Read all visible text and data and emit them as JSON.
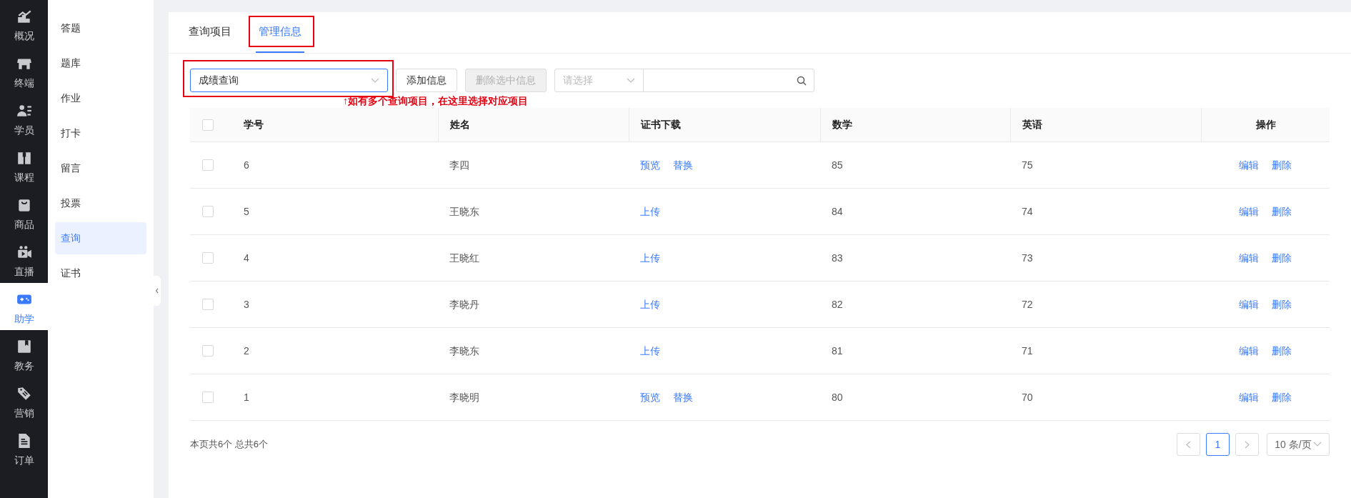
{
  "nav": [
    {
      "label": "概况",
      "selected": false
    },
    {
      "label": "终端",
      "selected": false
    },
    {
      "label": "学员",
      "selected": false
    },
    {
      "label": "课程",
      "selected": false
    },
    {
      "label": "商品",
      "selected": false
    },
    {
      "label": "直播",
      "selected": false
    },
    {
      "label": "助学",
      "selected": true
    },
    {
      "label": "教务",
      "selected": false
    },
    {
      "label": "营销",
      "selected": false
    },
    {
      "label": "订单",
      "selected": false
    }
  ],
  "submenu": [
    {
      "label": "答题",
      "selected": false
    },
    {
      "label": "题库",
      "selected": false
    },
    {
      "label": "作业",
      "selected": false
    },
    {
      "label": "打卡",
      "selected": false
    },
    {
      "label": "留言",
      "selected": false
    },
    {
      "label": "投票",
      "selected": false
    },
    {
      "label": "查询",
      "selected": true
    },
    {
      "label": "证书",
      "selected": false
    }
  ],
  "tabs": [
    {
      "label": "查询项目",
      "selected": false,
      "highlighted": false
    },
    {
      "label": "管理信息",
      "selected": true,
      "highlighted": true
    }
  ],
  "toolbar": {
    "project_select": {
      "value": "成绩查询",
      "highlighted": true
    },
    "buttons": [
      {
        "label": "添加信息",
        "disabled": false
      },
      {
        "label": "删除选中信息",
        "disabled": true
      }
    ],
    "filter_select": {
      "placeholder": "请选择"
    }
  },
  "annotation": "↑如有多个查询项目，在这里选择对应项目",
  "table": {
    "select_all_checked": false,
    "columns": [
      "学号",
      "姓名",
      "证书下载",
      "数学",
      "英语",
      "操作"
    ],
    "rows": [
      {
        "checked": false,
        "id": "6",
        "name": "李四",
        "cert_actions": [
          "预览",
          "替换"
        ],
        "math": "85",
        "english": "75",
        "actions": [
          "编辑",
          "删除"
        ]
      },
      {
        "checked": false,
        "id": "5",
        "name": "王晓东",
        "cert_actions": [
          "上传"
        ],
        "math": "84",
        "english": "74",
        "actions": [
          "编辑",
          "删除"
        ]
      },
      {
        "checked": false,
        "id": "4",
        "name": "王晓红",
        "cert_actions": [
          "上传"
        ],
        "math": "83",
        "english": "73",
        "actions": [
          "编辑",
          "删除"
        ]
      },
      {
        "checked": false,
        "id": "3",
        "name": "李晓丹",
        "cert_actions": [
          "上传"
        ],
        "math": "82",
        "english": "72",
        "actions": [
          "编辑",
          "删除"
        ]
      },
      {
        "checked": false,
        "id": "2",
        "name": "李晓东",
        "cert_actions": [
          "上传"
        ],
        "math": "81",
        "english": "71",
        "actions": [
          "编辑",
          "删除"
        ]
      },
      {
        "checked": false,
        "id": "1",
        "name": "李晓明",
        "cert_actions": [
          "预览",
          "替换"
        ],
        "math": "80",
        "english": "70",
        "actions": [
          "编辑",
          "删除"
        ]
      }
    ]
  },
  "footer": {
    "summary": "本页共6个 总共6个",
    "pages": [
      {
        "label": "1",
        "selected": true
      }
    ],
    "page_size": "10 条/页"
  }
}
